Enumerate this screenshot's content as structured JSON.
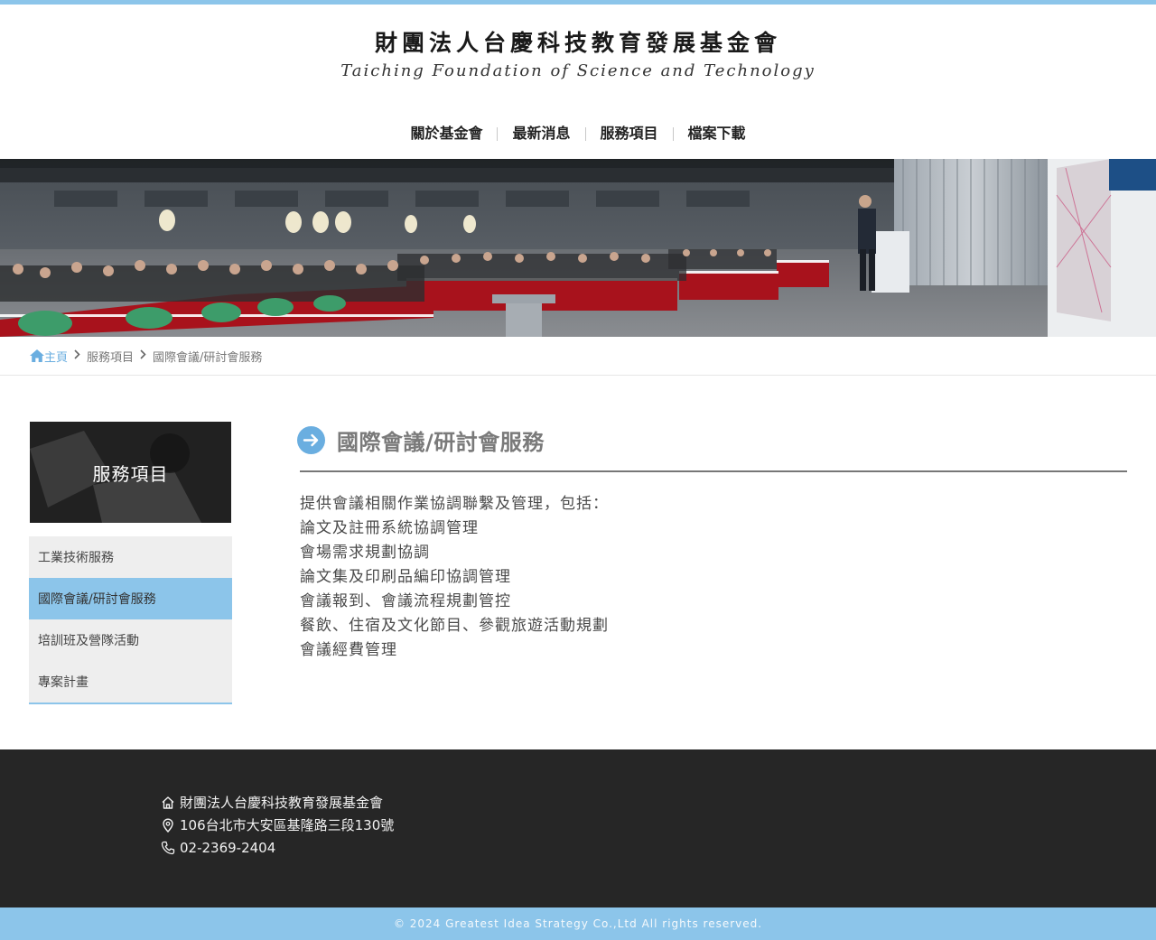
{
  "logo": {
    "title_cn": "財團法人台慶科技教育發展基金會",
    "title_en": "Taiching Foundation of Science and Technology"
  },
  "nav": {
    "items": [
      {
        "label": "關於基金會"
      },
      {
        "label": "最新消息"
      },
      {
        "label": "服務項目"
      },
      {
        "label": "檔案下載"
      }
    ]
  },
  "breadcrumb": {
    "home": "主頁",
    "items": [
      {
        "label": "服務項目"
      },
      {
        "label": "國際會議/研討會服務"
      }
    ]
  },
  "sidebar": {
    "hero_title": "服務項目",
    "items": [
      {
        "label": "工業技術服務"
      },
      {
        "label": "國際會議/研討會服務",
        "active": true
      },
      {
        "label": "培訓班及營隊活動"
      },
      {
        "label": "專案計畫"
      }
    ]
  },
  "content": {
    "title": "國際會議/研討會服務",
    "lines": [
      "提供會議相關作業協調聯繫及管理，包括：",
      "論文及註冊系統協調管理",
      "會場需求規劃協調",
      "論文集及印刷品編印協調管理",
      "會議報到、會議流程規劃管控",
      "餐飲、住宿及文化節目、參觀旅遊活動規劃",
      "會議經費管理"
    ]
  },
  "footer": {
    "org": "財團法人台慶科技教育發展基金會",
    "address": "106台北市大安區基隆路三段130號",
    "phone": "02-2369-2404",
    "copyright": "© 2024 Greatest Idea Strategy Co.,Ltd All rights reserved."
  },
  "icons": {
    "home": "home-icon",
    "breadcrumb_separator": "chevron-right-icon",
    "title_bullet": "arrow-right-circle-icon",
    "footer_org": "house-icon",
    "footer_address": "map-pin-icon",
    "footer_phone": "phone-icon"
  },
  "colors": {
    "accent": "#8cc5ea",
    "accent_dark": "#6aaee0",
    "footer_bg": "#262626",
    "title_gray": "#7a7a7a"
  }
}
